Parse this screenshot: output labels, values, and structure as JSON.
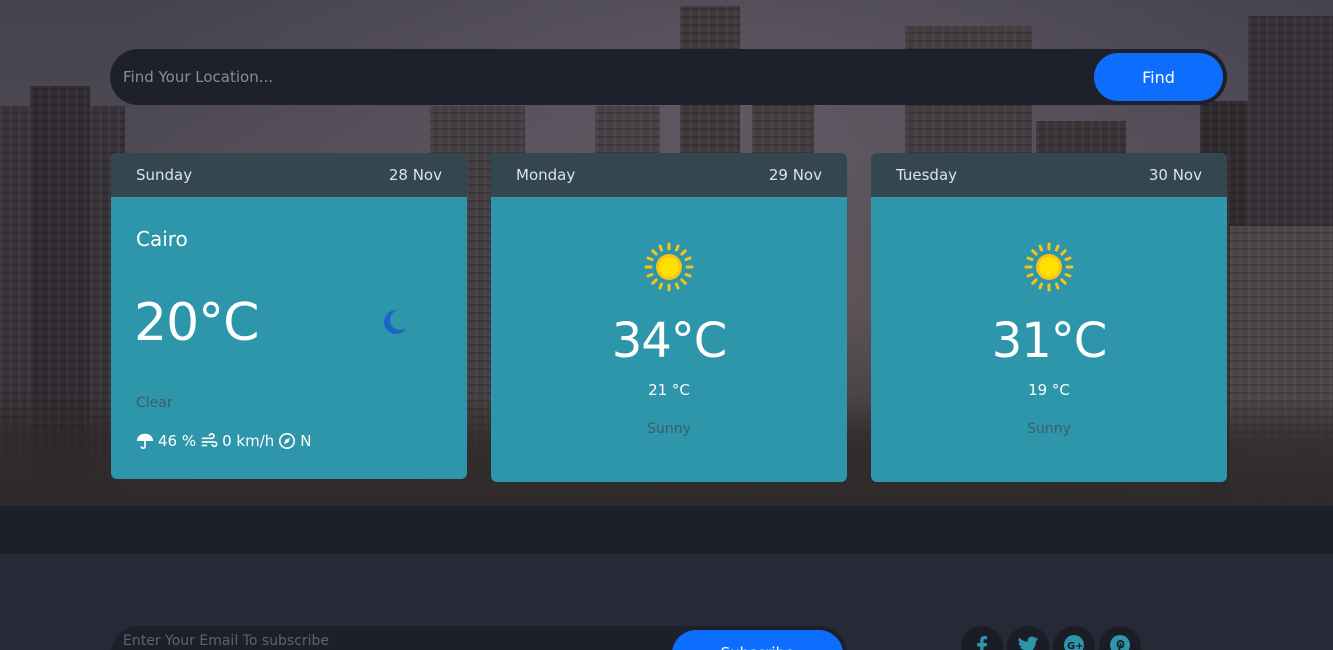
{
  "search": {
    "placeholder": "Find Your Location...",
    "button_label": "Find"
  },
  "today": {
    "day": "Sunday",
    "date": "28 Nov",
    "city": "Cairo",
    "temp": "20°C",
    "icon": "moon-icon",
    "condition": "Clear",
    "humidity": "46 %",
    "wind": "0 km/h",
    "direction": "N"
  },
  "forecast": [
    {
      "day": "Monday",
      "date": "29 Nov",
      "icon": "sun-icon",
      "max": "34°C",
      "min": "21 °C",
      "condition": "Sunny"
    },
    {
      "day": "Tuesday",
      "date": "30 Nov",
      "icon": "sun-icon",
      "max": "31°C",
      "min": "19 °C",
      "condition": "Sunny"
    }
  ],
  "footer": {
    "email_placeholder": "Enter Your Email To subscribe",
    "subscribe_label": "Subscribe",
    "social_icons": [
      "facebook-icon",
      "twitter-icon",
      "google-plus-icon",
      "pinterest-icon"
    ]
  },
  "colors": {
    "accent": "#0d6efd",
    "card": "#2e96ab",
    "card_header": "#344650",
    "page_bg": "#262936"
  }
}
